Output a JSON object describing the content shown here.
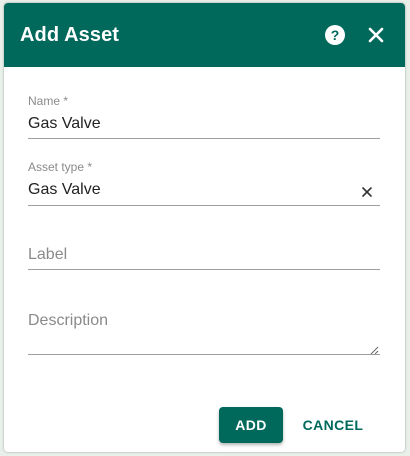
{
  "dialog": {
    "title": "Add Asset",
    "header_color": "#00695c",
    "icons": {
      "help": "help-circle-icon",
      "close": "close-icon"
    }
  },
  "form": {
    "name": {
      "label": "Name *",
      "value": "Gas Valve"
    },
    "asset_type": {
      "label": "Asset type *",
      "value": "Gas Valve",
      "clear_icon": "clear-x-icon"
    },
    "label_field": {
      "placeholder": "Label"
    },
    "description": {
      "placeholder": "Description",
      "resize_icon": "resize-handle-icon"
    }
  },
  "actions": {
    "add_label": "ADD",
    "cancel_label": "CANCEL"
  }
}
